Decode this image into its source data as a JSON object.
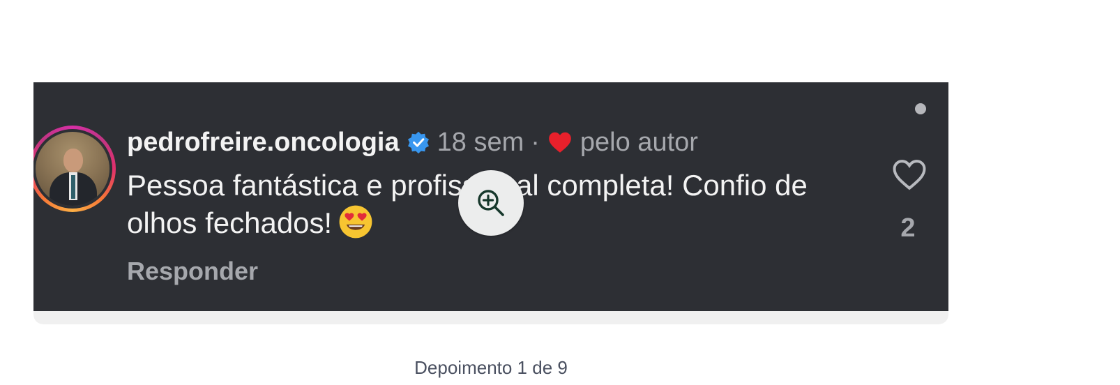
{
  "comment": {
    "username": "pedrofreire.oncologia",
    "verified_icon": "verified-badge-icon",
    "time": "18 sem",
    "separator": "·",
    "liked_by_author_label": "pelo autor",
    "text": "Pessoa fantástica e profissional completa! Confio de olhos fechados!",
    "emoji": "😍",
    "reply_label": "Responder",
    "like_count": "2",
    "colors": {
      "background": "#2d2f34",
      "text": "#f3f3f3",
      "muted": "#a6a8ad",
      "verified": "#3897f0",
      "heart": "#e8202b"
    }
  },
  "zoom": {
    "icon": "zoom-in-icon"
  },
  "caption": {
    "text": "Depoimento 1 de 9"
  }
}
